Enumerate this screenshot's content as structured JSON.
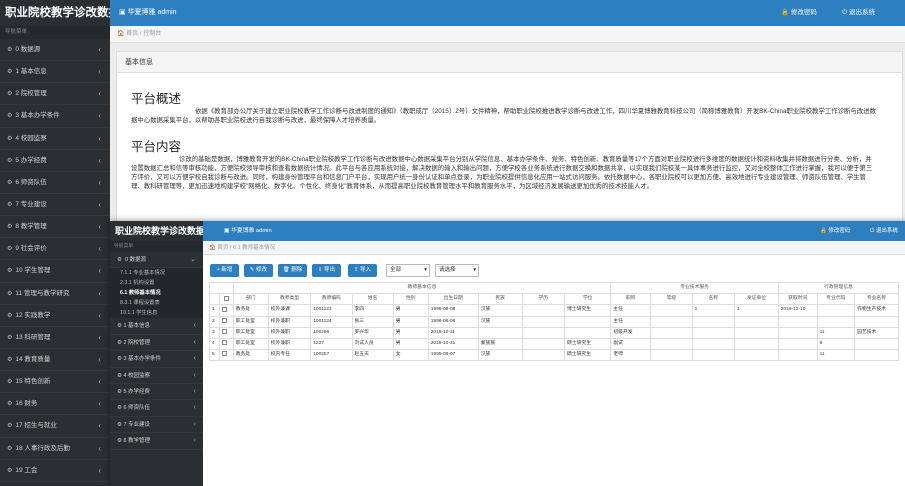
{
  "app": {
    "title": "职业院校教学诊改数据",
    "user": "华夏博雅 admin",
    "change_pwd": "修改密码",
    "logout": "退出系统"
  },
  "sidebar": {
    "nav_label": "导航菜单",
    "items": [
      "0 数据源",
      "1 基本信息",
      "2 院校管理",
      "3 基本办学条件",
      "4 校园监察",
      "5 办学经费",
      "6 师资队伍",
      "7 专业建设",
      "8 教学管理",
      "9 社会评价",
      "10 学生管理",
      "11 管理与教学研究",
      "12 实践教学",
      "13 科研管理",
      "14 教育质量",
      "15 特色创新",
      "16 财务",
      "17 招生与就业",
      "18 人事行政及后勤",
      "19 工会"
    ]
  },
  "breadcrumb": {
    "home": "首页",
    "current": "控制台"
  },
  "panel": {
    "header": "基本信息",
    "overview_title": "平台概述",
    "overview_text": "依据《教育部办公厅关于建立职业院校教学工作诊断与改进制度的通知》（教职成厅〔2015〕2号）文件精神，帮助职业院校推进教学诊断与改进工作，四川华夏博雅教育科技公司（简称博雅教育）开发BK-China职业院校教学工作诊断与改进数据中心数据采集平台，以帮助各职业院校进行自我诊断与改进，最终保障人才培养质量。",
    "content_title": "平台内容",
    "content_text": "诊改的基础是数据，博雅教育开发的BK-China职业院校教学工作诊断与改进数据中心数据采集平台分别从学院信息、基本办学条件、党务、特色创新、教育质量等17个方面对职业院校进行多维度的数据统计和资料收集并将数据进行分类、分析，并设置数据汇总和信等审核功能，方便院校领导审核和查看数据统计情况。此平台与各应用系统对接，解决数据的输入和输出问题，方便学校各业务系统进行数据交换和数据共享，以实现我们院校某一具体事务进行监控，又对全校整体工作进行掌握，我可以便于第三方评价，又可以方便学校自我诊断与改进。同时，构建身份管理平台和信息门户平台，实现用户统一身份认证和单点登录，为职业院校提供信息化应用一站式访问服务。依托数据中心，各职业院校可以更加方便、高效地进行专业建设管理、师资队伍管理、学生管理、教科研管理等，更加迅速地构建学校\"网络化、数字化、个性化、终身化\"教育体系，从而提高职业院校教育管理水平和教育服务水平，为区域经济发展输送更加优秀的技术技能人才。"
  },
  "inner": {
    "title": "职业院校教学诊改数据",
    "user": "华夏博雅 admin",
    "change_pwd": "修改密码",
    "logout": "退出系统",
    "nav_label": "导航菜单",
    "menu_top": "0 数据源",
    "subitems": [
      "7.1.1 专业基本情况",
      "2.3.1 机构设置",
      "6.1 教师基本情况",
      "8.3.1 课程设置表",
      "10.1.1 学生信息"
    ],
    "menu_rest": [
      "1 基本信息",
      "2 院校管理",
      "3 基本办学条件",
      "4 校园监察",
      "5 办学经费",
      "6 师资队伍",
      "7 专业建设",
      "8 教学管理"
    ],
    "breadcrumb_home": "首页",
    "breadcrumb_current": "6.1 教师基本情况",
    "toolbar": {
      "add": "+ 新增",
      "edit": "✎ 修改",
      "delete": "🗑 删除",
      "export": "⇩ 导出",
      "import": "⇧ 导入",
      "filter1": "全部",
      "filter2": "请选择"
    },
    "table": {
      "group1": "教师基本信息",
      "group2": "专业技术服务",
      "group3": "行政管理信息",
      "headers": [
        "",
        "部门",
        "教师类型",
        "教师编码",
        "姓名",
        "性别",
        "出生日期",
        "民族",
        "学历",
        "学位",
        "职称",
        "等级",
        "名称",
        "发证单位",
        "获取时间",
        "专业代码",
        "专业名称"
      ],
      "rows": [
        [
          "1",
          "",
          "教务处",
          "校外兼课",
          "1001123",
          "李四",
          "男",
          "1996-08-08",
          "汉族",
          "",
          "博士研究生",
          "主任",
          "",
          "1",
          "1",
          "2018-12-10",
          "",
          "作物生产技术"
        ],
        [
          "2",
          "",
          "职工处室",
          "校外兼职",
          "1001124",
          "张三",
          "男",
          "1996-08-08",
          "汉族",
          "",
          "",
          "主任",
          "",
          "",
          "",
          "",
          "",
          ""
        ],
        [
          "3",
          "",
          "职工处室",
          "校外兼职",
          "100256",
          "罗兴华",
          "男",
          "2018-10-11",
          "",
          "",
          "",
          "初级开发",
          "",
          "",
          "",
          "",
          "11",
          "园艺技术"
        ],
        [
          "4",
          "",
          "职工处室",
          "校外兼职",
          "1227",
          "刘试人员",
          "男",
          "2018-10-31",
          "蒙族族",
          "",
          "硕士研究生",
          "副试",
          "",
          "",
          "",
          "",
          "9",
          ""
        ],
        [
          "5",
          "",
          "教务处",
          "校内专任",
          "100257",
          "赵五天",
          "女",
          "1995-08-07",
          "汉族",
          "",
          "硕士研究生",
          "老师",
          "",
          "",
          "",
          "",
          "11",
          ""
        ]
      ]
    }
  }
}
